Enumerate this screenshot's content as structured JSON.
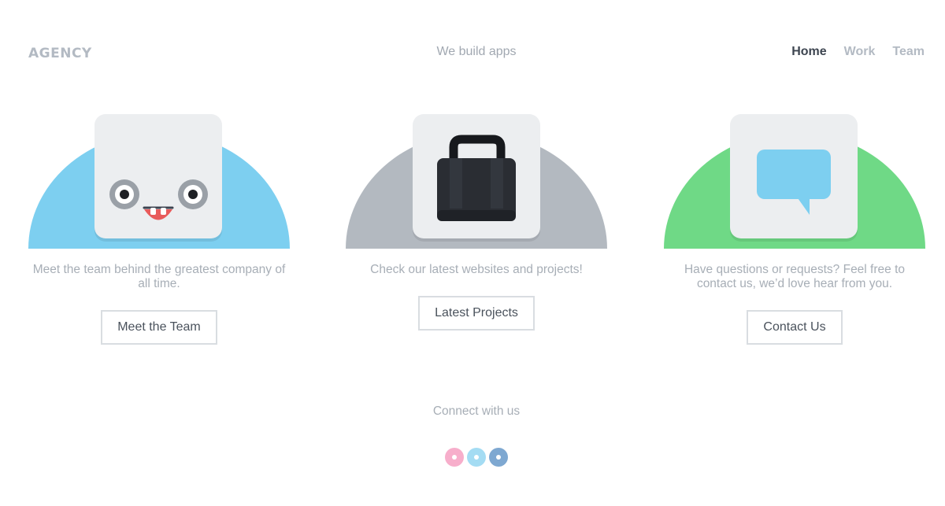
{
  "header": {
    "logo": "AGENCY",
    "tagline": "We build apps",
    "nav": [
      {
        "label": "Home",
        "active": true
      },
      {
        "label": "Work",
        "active": false
      },
      {
        "label": "Team",
        "active": false
      }
    ]
  },
  "cards": [
    {
      "illustration": "smiley-face-icon",
      "bg_color": "#7dcff0",
      "description": "Meet the team behind the greatest company of all time.",
      "button_label": "Meet the Team"
    },
    {
      "illustration": "shopping-bag-icon",
      "bg_color": "#b3b9c0",
      "description": "Check our latest websites and projects!",
      "button_label": "Latest Projects"
    },
    {
      "illustration": "chat-bubble-icon",
      "bg_color": "#6fd986",
      "description": "Have questions or requests? Feel free to contact us, we’d love hear from you.",
      "button_label": "Contact Us"
    }
  ],
  "footer": {
    "connect_label": "Connect with us",
    "social": [
      {
        "name": "social-link-pink",
        "color": "#f7aecb"
      },
      {
        "name": "social-link-light-blue",
        "color": "#a4dcf3"
      },
      {
        "name": "social-link-blue",
        "color": "#7ea8d1"
      }
    ]
  }
}
